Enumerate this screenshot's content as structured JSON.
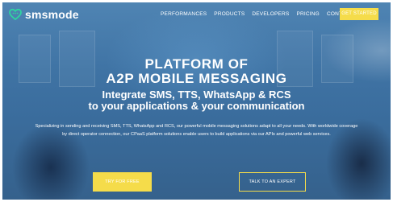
{
  "brand": {
    "name": "smsmode",
    "icon": "smsmode-heart-logo-icon"
  },
  "nav": {
    "items": [
      "PERFORMANCES",
      "PRODUCTS",
      "DEVELOPERS",
      "PRICING",
      "CONTACT"
    ],
    "cta": "GET STARTED"
  },
  "hero": {
    "title_line1": "PLATFORM OF",
    "title_line2": "A2P MOBILE MESSAGING",
    "subtitle_line1": "Integrate SMS, TTS, WhatsApp & RCS",
    "subtitle_line2": "to your applications & your communication",
    "description": "Specializing in sending and receiving SMS, TTS, WhatsApp and RCS, our powerful mobile messaging solutions adapt to all your needs. With worldwide coverage by direct operator connection, our CPaaS platform solutions enable users to build applications via our APIs and powerful web services.",
    "primary_button": "TRY FOR FREE",
    "secondary_button": "TALK TO AN EXPERT"
  },
  "colors": {
    "accent": "#f5dc4a",
    "overlay": "#3f73a4",
    "logo_green": "#2fd3a0"
  }
}
